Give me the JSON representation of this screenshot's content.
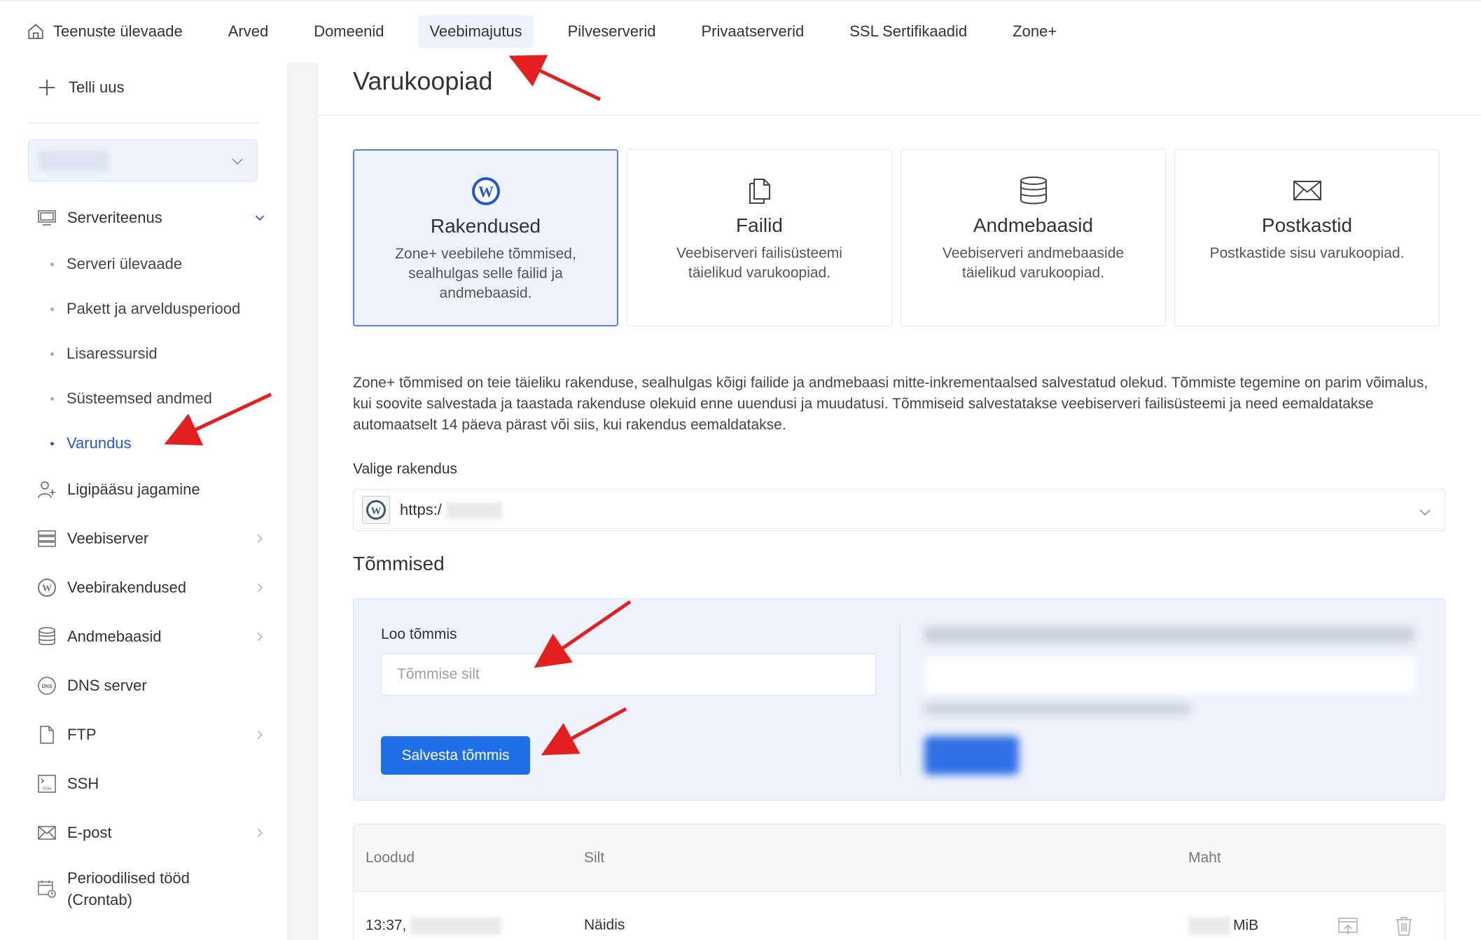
{
  "topnav": {
    "items": [
      {
        "label": "Teenuste ülevaade"
      },
      {
        "label": "Arved"
      },
      {
        "label": "Domeenid"
      },
      {
        "label": "Veebimajutus"
      },
      {
        "label": "Pilveserverid"
      },
      {
        "label": "Privaatserverid"
      },
      {
        "label": "SSL Sertifikaadid"
      },
      {
        "label": "Zone+"
      }
    ],
    "active_index": 3
  },
  "sidebar": {
    "order_new": "Telli uus",
    "server_service": "Serveriteenus",
    "sub_items": [
      {
        "label": "Serveri ülevaade"
      },
      {
        "label": "Pakett ja arveldusperiood"
      },
      {
        "label": "Lisaressursid"
      },
      {
        "label": "Süsteemsed andmed"
      },
      {
        "label": "Varundus"
      }
    ],
    "items": [
      {
        "label": "Ligipääsu jagamine"
      },
      {
        "label": "Veebiserver"
      },
      {
        "label": "Veebirakendused"
      },
      {
        "label": "Andmebaasid"
      },
      {
        "label": "DNS server"
      },
      {
        "label": "FTP"
      },
      {
        "label": "SSH"
      },
      {
        "label": "E-post"
      },
      {
        "label": "Perioodilised tööd"
      },
      {
        "label": "(Crontab)"
      }
    ]
  },
  "main": {
    "title": "Varukoopiad",
    "cards": [
      {
        "title": "Rakendused",
        "desc": "Zone+ veebilehe tõmmised, sealhulgas selle failid ja andmebaasid."
      },
      {
        "title": "Failid",
        "desc": "Veebiserveri failisüsteemi täielikud varukoopiad."
      },
      {
        "title": "Andmebaasid",
        "desc": "Veebiserveri andmebaaside täielikud varukoopiad."
      },
      {
        "title": "Postkastid",
        "desc": "Postkastide sisu varukoopiad."
      }
    ],
    "intro": "Zone+ tõmmised on teie täieliku rakenduse, sealhulgas kõigi failide ja andmebaasi mitte-inkrementaalsed salvestatud olekud. Tõmmiste tegemine on parim võimalus, kui soovite salvestada ja taastada rakenduse olekuid enne uuendusi ja muudatusi. Tõmmiseid salvestatakse veebiserveri failisüsteemi ja need eemaldatakse automaatselt 14 päeva pärast või siis, kui rakendus eemaldatakse.",
    "select_label": "Valige rakendus",
    "select_value": "https:/",
    "snapshots_title": "Tõmmised",
    "create_label": "Loo tõmmis",
    "input_placeholder": "Tõmmise silt",
    "save_button": "Salvesta tõmmis",
    "table": {
      "headers": [
        "Loodud",
        "Silt",
        "Maht"
      ],
      "row": {
        "created": "13:37,",
        "label": "Näidis",
        "size_unit": "MiB"
      }
    }
  },
  "colors": {
    "accent": "#1f6fe8",
    "active_link": "#2558c8",
    "panel_bg": "#eef2fb",
    "annotation": "#e32020"
  }
}
